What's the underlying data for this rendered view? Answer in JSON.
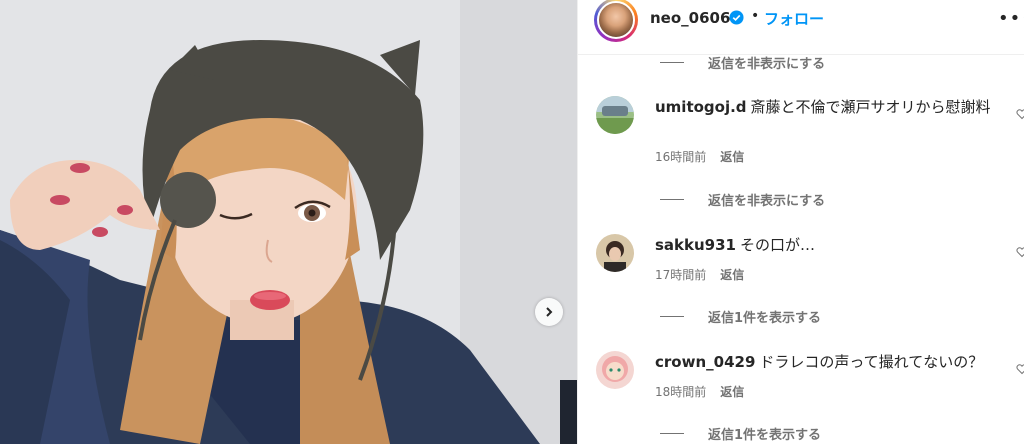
{
  "header": {
    "username": "neo_0606",
    "separator": "•",
    "follow_label": "フォロー",
    "more_label": "•••"
  },
  "comments": [
    {
      "username": "umitogoj.d",
      "text": "斎藤と不倫で瀬戸サオリから慰謝料",
      "time": "16時間前",
      "reply_label": "返信"
    },
    {
      "username": "sakku931",
      "text": "その口が…",
      "time": "17時間前",
      "reply_label": "返信"
    },
    {
      "username": "crown_0429",
      "text": "ドラレコの声って撮れてないの？",
      "time": "18時間前",
      "reply_label": "返信"
    }
  ],
  "reply_toggles": {
    "hide_top": "返信を非表示にする",
    "hide_mid": "返信を非表示にする",
    "show_mid": "返信1件を表示する",
    "show_bottom": "返信1件を表示する"
  },
  "colors": {
    "accent": "#0095f6",
    "verified": "#0095f6",
    "text": "#262626",
    "secondary": "#737373"
  }
}
